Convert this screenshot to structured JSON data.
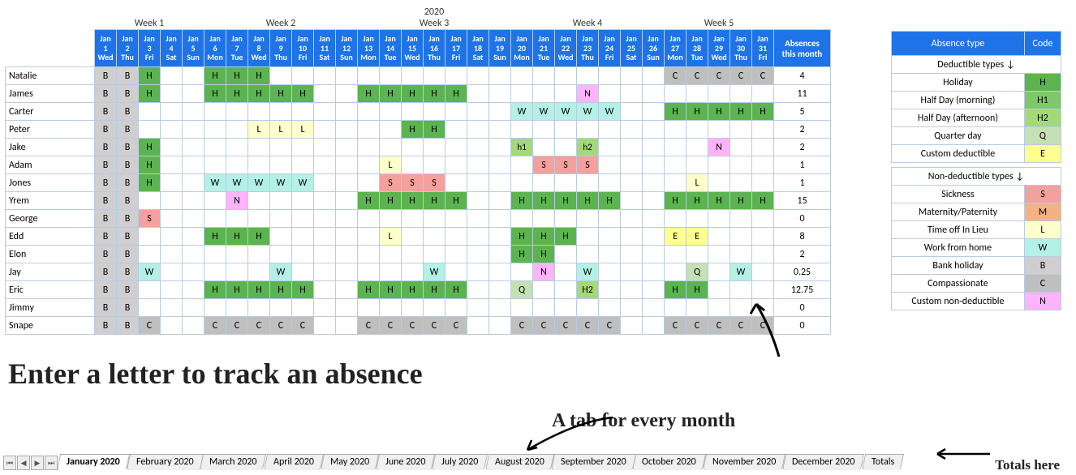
{
  "year": "2020",
  "weeks": [
    "Week 1",
    "Week 2",
    "Week 3",
    "Week 4",
    "Week 5"
  ],
  "week_spans": [
    5,
    7,
    7,
    7,
    5
  ],
  "days": [
    {
      "m": "Jan",
      "d": "1",
      "w": "Wed"
    },
    {
      "m": "Jan",
      "d": "2",
      "w": "Thu"
    },
    {
      "m": "Jan",
      "d": "3",
      "w": "Fri"
    },
    {
      "m": "Jan",
      "d": "4",
      "w": "Sat"
    },
    {
      "m": "Jan",
      "d": "5",
      "w": "Sun"
    },
    {
      "m": "Jan",
      "d": "6",
      "w": "Mon"
    },
    {
      "m": "Jan",
      "d": "7",
      "w": "Tue"
    },
    {
      "m": "Jan",
      "d": "8",
      "w": "Wed"
    },
    {
      "m": "Jan",
      "d": "9",
      "w": "Thu"
    },
    {
      "m": "Jan",
      "d": "10",
      "w": "Fri"
    },
    {
      "m": "Jan",
      "d": "11",
      "w": "Sat"
    },
    {
      "m": "Jan",
      "d": "12",
      "w": "Sun"
    },
    {
      "m": "Jan",
      "d": "13",
      "w": "Mon"
    },
    {
      "m": "Jan",
      "d": "14",
      "w": "Tue"
    },
    {
      "m": "Jan",
      "d": "15",
      "w": "Wed"
    },
    {
      "m": "Jan",
      "d": "16",
      "w": "Thu"
    },
    {
      "m": "Jan",
      "d": "17",
      "w": "Fri"
    },
    {
      "m": "Jan",
      "d": "18",
      "w": "Sat"
    },
    {
      "m": "Jan",
      "d": "19",
      "w": "Sun"
    },
    {
      "m": "Jan",
      "d": "20",
      "w": "Mon"
    },
    {
      "m": "Jan",
      "d": "21",
      "w": "Tue"
    },
    {
      "m": "Jan",
      "d": "22",
      "w": "Wed"
    },
    {
      "m": "Jan",
      "d": "23",
      "w": "Thu"
    },
    {
      "m": "Jan",
      "d": "24",
      "w": "Fri"
    },
    {
      "m": "Jan",
      "d": "25",
      "w": "Sat"
    },
    {
      "m": "Jan",
      "d": "26",
      "w": "Sun"
    },
    {
      "m": "Jan",
      "d": "27",
      "w": "Mon"
    },
    {
      "m": "Jan",
      "d": "28",
      "w": "Tue"
    },
    {
      "m": "Jan",
      "d": "29",
      "w": "Wed"
    },
    {
      "m": "Jan",
      "d": "30",
      "w": "Thu"
    },
    {
      "m": "Jan",
      "d": "31",
      "w": "Fri"
    }
  ],
  "absences_header": "Absences this month",
  "employees": [
    {
      "name": "Natalie",
      "cells": [
        "B",
        "B",
        "H",
        "",
        "",
        "H",
        "H",
        "H",
        "",
        "",
        "",
        "",
        "",
        "",
        "",
        "",
        "",
        "",
        "",
        "",
        "",
        "",
        "",
        "",
        "",
        "",
        "C",
        "C",
        "C",
        "C",
        "C"
      ],
      "total": "4"
    },
    {
      "name": "James",
      "cells": [
        "B",
        "B",
        "H",
        "",
        "",
        "H",
        "H",
        "H",
        "H",
        "H",
        "",
        "",
        "H",
        "H",
        "H",
        "H",
        "H",
        "",
        "",
        "",
        "",
        "",
        "N",
        "",
        "",
        "",
        "",
        "",
        "",
        "",
        ""
      ],
      "total": "11"
    },
    {
      "name": "Carter",
      "cells": [
        "B",
        "B",
        "",
        "",
        "",
        "",
        "",
        "",
        "",
        "",
        "",
        "",
        "",
        "",
        "",
        "",
        "",
        "",
        "",
        "W",
        "W",
        "W",
        "W",
        "W",
        "",
        "",
        "H",
        "H",
        "H",
        "H",
        "H"
      ],
      "total": "5"
    },
    {
      "name": "Peter",
      "cells": [
        "B",
        "B",
        "",
        "",
        "",
        "",
        "",
        "L",
        "L",
        "L",
        "",
        "",
        "",
        "",
        "H",
        "H",
        "",
        "",
        "",
        "",
        "",
        "",
        "",
        "",
        "",
        "",
        "",
        "",
        "",
        "",
        ""
      ],
      "total": "2"
    },
    {
      "name": "Jake",
      "cells": [
        "B",
        "B",
        "H",
        "",
        "",
        "",
        "",
        "",
        "",
        "",
        "",
        "",
        "",
        "",
        "",
        "",
        "",
        "",
        "",
        "h1",
        "",
        "",
        "h2",
        "",
        "",
        "",
        "",
        "",
        "N",
        "",
        ""
      ],
      "total": "2"
    },
    {
      "name": "Adam",
      "cells": [
        "B",
        "B",
        "H",
        "",
        "",
        "",
        "",
        "",
        "",
        "",
        "",
        "",
        "",
        "L",
        "",
        "",
        "",
        "",
        "",
        "",
        "S",
        "S",
        "S",
        "",
        "",
        "",
        "",
        "",
        "",
        "",
        ""
      ],
      "total": "1"
    },
    {
      "name": "Jones",
      "cells": [
        "B",
        "B",
        "H",
        "",
        "",
        "W",
        "W",
        "W",
        "W",
        "W",
        "",
        "",
        "",
        "S",
        "S",
        "S",
        "",
        "",
        "",
        "",
        "",
        "",
        "",
        "",
        "",
        "",
        "",
        "L",
        "",
        "",
        ""
      ],
      "total": "1"
    },
    {
      "name": "Yrem",
      "cells": [
        "B",
        "B",
        "",
        "",
        "",
        "",
        "N",
        "",
        "",
        "",
        "",
        "",
        "H",
        "H",
        "H",
        "H",
        "H",
        "",
        "",
        "H",
        "H",
        "H",
        "H",
        "H",
        "",
        "",
        "H",
        "H",
        "H",
        "H",
        "H"
      ],
      "total": "15"
    },
    {
      "name": "George",
      "cells": [
        "B",
        "B",
        "S",
        "",
        "",
        "",
        "",
        "",
        "",
        "",
        "",
        "",
        "",
        "",
        "",
        "",
        "",
        "",
        "",
        "",
        "",
        "",
        "",
        "",
        "",
        "",
        "",
        "",
        "",
        "",
        ""
      ],
      "total": "0"
    },
    {
      "name": "Edd",
      "cells": [
        "B",
        "B",
        "",
        "",
        "",
        "H",
        "H",
        "H",
        "",
        "",
        "",
        "",
        "",
        "L",
        "",
        "",
        "",
        "",
        "",
        "H",
        "H",
        "H",
        "",
        "",
        "",
        "",
        "E",
        "E",
        "",
        "",
        ""
      ],
      "total": "8"
    },
    {
      "name": "Elon",
      "cells": [
        "B",
        "B",
        "",
        "",
        "",
        "",
        "",
        "",
        "",
        "",
        "",
        "",
        "",
        "",
        "",
        "",
        "",
        "",
        "",
        "H",
        "H",
        "",
        "",
        "",
        "",
        "",
        "",
        "",
        "",
        "",
        ""
      ],
      "total": "2"
    },
    {
      "name": "Jay",
      "cells": [
        "B",
        "B",
        "W",
        "",
        "",
        "",
        "",
        "",
        "W",
        "",
        "",
        "",
        "",
        "",
        "",
        "W",
        "",
        "",
        "",
        "",
        "N",
        "",
        "W",
        "",
        "",
        "",
        "",
        "Q",
        "",
        "W",
        ""
      ],
      "total": "0.25"
    },
    {
      "name": "Eric",
      "cells": [
        "B",
        "B",
        "",
        "",
        "",
        "H",
        "H",
        "H",
        "H",
        "H",
        "",
        "",
        "H",
        "H",
        "H",
        "H",
        "H",
        "",
        "",
        "Q",
        "",
        "",
        "H2",
        "",
        "",
        "",
        "H",
        "H",
        "",
        "",
        ""
      ],
      "total": "12.75"
    },
    {
      "name": "Jimmy",
      "cells": [
        "B",
        "B",
        "",
        "",
        "",
        "",
        "",
        "",
        "",
        "",
        "",
        "",
        "",
        "",
        "",
        "",
        "",
        "",
        "",
        "",
        "",
        "",
        "",
        "",
        "",
        "",
        "",
        "",
        "",
        "",
        ""
      ],
      "total": "0"
    },
    {
      "name": "Snape",
      "cells": [
        "B",
        "B",
        "C",
        "",
        "",
        "C",
        "C",
        "C",
        "C",
        "C",
        "",
        "",
        "C",
        "C",
        "C",
        "C",
        "C",
        "",
        "",
        "C",
        "C",
        "C",
        "C",
        "C",
        "",
        "",
        "C",
        "C",
        "C",
        "C",
        "C"
      ],
      "total": "0"
    }
  ],
  "legend": {
    "header_type": "Absence type",
    "header_code": "Code",
    "deductible_label": "Deductible types ↓",
    "nondeductible_label": "Non-deductible types ↓",
    "deductible": [
      {
        "label": "Holiday",
        "code": "H",
        "cls": "H"
      },
      {
        "label": "Half Day (morning)",
        "code": "H1",
        "cls": "H1"
      },
      {
        "label": "Half Day (afternoon)",
        "code": "H2",
        "cls": "H2"
      },
      {
        "label": "Quarter day",
        "code": "Q",
        "cls": "Q"
      },
      {
        "label": "Custom deductible",
        "code": "E",
        "cls": "E"
      }
    ],
    "nondeductible": [
      {
        "label": "Sickness",
        "code": "S",
        "cls": "S"
      },
      {
        "label": "Maternity/Paternity",
        "code": "M",
        "cls": "M"
      },
      {
        "label": "Time off In Lieu",
        "code": "L",
        "cls": "L"
      },
      {
        "label": "Work from home",
        "code": "W",
        "cls": "W"
      },
      {
        "label": "Bank holiday",
        "code": "B",
        "cls": "B"
      },
      {
        "label": "Compassionate",
        "code": "C",
        "cls": "C"
      },
      {
        "label": "Custom non-deductible",
        "code": "N",
        "cls": "N"
      }
    ]
  },
  "tabs": [
    "January 2020",
    "February 2020",
    "March 2020",
    "April 2020",
    "May 2020",
    "June 2020",
    "July 2020",
    "August 2020",
    "September 2020",
    "October 2020",
    "November 2020",
    "December 2020",
    "Totals"
  ],
  "active_tab": "January 2020",
  "annot1": "Enter a letter to track an absence",
  "annot2": "A tab for every month",
  "annot3": "Totals here"
}
